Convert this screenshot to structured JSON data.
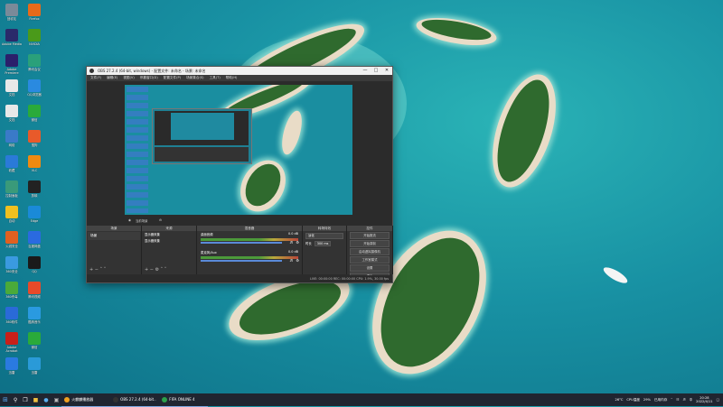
{
  "desktop": {
    "icons": [
      {
        "label": "回收站",
        "icon": "recycle-bin-icon",
        "color": "#7a8a99",
        "col": 0,
        "row": 0
      },
      {
        "label": "Adobe Media",
        "icon": "media-encoder-icon",
        "color": "#2a2a6a",
        "col": 0,
        "row": 1
      },
      {
        "label": "Adobe Premiere",
        "icon": "premiere-icon",
        "color": "#2b1f6b",
        "col": 0,
        "row": 2
      },
      {
        "label": "文档",
        "icon": "document-icon",
        "color": "#e8e8e8",
        "col": 0,
        "row": 3
      },
      {
        "label": "文档",
        "icon": "document-icon",
        "color": "#e8e8e8",
        "col": 0,
        "row": 4
      },
      {
        "label": "网络",
        "icon": "network-icon",
        "color": "#3a7ac8",
        "col": 0,
        "row": 5
      },
      {
        "label": "收藏",
        "icon": "star-icon",
        "color": "#2a7ad8",
        "col": 0,
        "row": 6
      },
      {
        "label": "控制面板",
        "icon": "control-panel-icon",
        "color": "#3a9a7a",
        "col": 0,
        "row": 7
      },
      {
        "label": "自动",
        "icon": "auto-icon",
        "color": "#f0c020",
        "col": 0,
        "row": 8
      },
      {
        "label": "火绒安全",
        "icon": "shield-app-icon",
        "color": "#e06020",
        "col": 0,
        "row": 9
      },
      {
        "label": "360安全",
        "icon": "security-360-icon",
        "color": "#3a9ae0",
        "col": 0,
        "row": 10
      },
      {
        "label": "360杀毒",
        "icon": "antivirus-icon",
        "color": "#4aaa3a",
        "col": 0,
        "row": 11
      },
      {
        "label": "360软件",
        "icon": "software-icon",
        "color": "#2a6ad8",
        "col": 0,
        "row": 12
      },
      {
        "label": "Adobe Acrobat",
        "icon": "acrobat-icon",
        "color": "#c8201a",
        "col": 0,
        "row": 13
      },
      {
        "label": "迅雷",
        "icon": "thunder-icon",
        "color": "#2a7ae0",
        "col": 0,
        "row": 14
      },
      {
        "label": "Firefox",
        "icon": "firefox-icon",
        "color": "#e86a1a",
        "col": 1,
        "row": 0
      },
      {
        "label": "NVIDIA",
        "icon": "nvidia-icon",
        "color": "#4a9a1a",
        "col": 1,
        "row": 1
      },
      {
        "label": "腾讯会议",
        "icon": "meeting-icon",
        "color": "#2aa07a",
        "col": 1,
        "row": 2
      },
      {
        "label": "QQ浏览器",
        "icon": "qq-browser-icon",
        "color": "#2a8ae0",
        "col": 1,
        "row": 3
      },
      {
        "label": "微信",
        "icon": "wechat-icon",
        "color": "#2aaa3a",
        "col": 1,
        "row": 4
      },
      {
        "label": "搜狗",
        "icon": "sogou-icon",
        "color": "#e85a2a",
        "col": 1,
        "row": 5
      },
      {
        "label": "VLC",
        "icon": "vlc-icon",
        "color": "#f08a10",
        "col": 1,
        "row": 6
      },
      {
        "label": "剪映",
        "icon": "capcut-icon",
        "color": "#222222",
        "col": 1,
        "row": 7
      },
      {
        "label": "Edge",
        "icon": "edge-icon",
        "color": "#1a8ad8",
        "col": 1,
        "row": 8
      },
      {
        "label": "百度网盘",
        "icon": "netdisk-icon",
        "color": "#2a6ae0",
        "col": 1,
        "row": 9
      },
      {
        "label": "QQ",
        "icon": "qq-icon",
        "color": "#1a1a1a",
        "col": 1,
        "row": 10
      },
      {
        "label": "腾讯视频",
        "icon": "tencent-video-icon",
        "color": "#e84a2a",
        "col": 1,
        "row": 11
      },
      {
        "label": "酷狗音乐",
        "icon": "kugou-icon",
        "color": "#2a9ae0",
        "col": 1,
        "row": 12
      },
      {
        "label": "微信",
        "icon": "wechat-icon",
        "color": "#2aaa3a",
        "col": 1,
        "row": 13
      },
      {
        "label": "迅雷",
        "icon": "thunder-icon",
        "color": "#2a9ad8",
        "col": 1,
        "row": 14
      }
    ]
  },
  "obs": {
    "title": "OBS 27.2.4 (64-bit, windows) - 配置文件: 未命名 - 场景: 未命名",
    "menu": [
      "文件(F)",
      "编辑(E)",
      "视图(V)",
      "停靠窗口(D)",
      "配置文件(P)",
      "场景集合(S)",
      "工具(T)",
      "帮助(H)"
    ],
    "controls_row": "当前场景",
    "docks": {
      "scenes": "场景",
      "sources": "来源",
      "mixer": "混音器",
      "transitions": "转场特效",
      "controls": "控件"
    },
    "scene_item": "场景",
    "source_items": [
      "显示器采集",
      "显示器采集"
    ],
    "mixer_tracks": [
      {
        "name": "桌面音频",
        "db": "0.0 dB"
      },
      {
        "name": "麦克风/Aux",
        "db": "0.0 dB"
      }
    ],
    "transition": {
      "type": "淡化",
      "duration_label": "时长",
      "duration": "300 ms"
    },
    "control_buttons": [
      "开始推流",
      "开始录制",
      "启动虚拟摄像机",
      "工作室模式",
      "设置",
      "退出"
    ],
    "status": "LIVE: 00:00:00   REC: 00:00:00   CPU: 1.9%, 30.00 fps"
  },
  "taskbar": {
    "items": [
      {
        "label": "火麒麟播放器",
        "icon": "player-icon",
        "color": "#f0a020"
      },
      {
        "label": "OBS 27.2.4 (64-bit...",
        "icon": "obs-icon",
        "color": "#333333"
      },
      {
        "label": "FIFA ONLINE 4",
        "icon": "fifa-icon",
        "color": "#2aa04a"
      }
    ],
    "tray": {
      "weather": "26°C",
      "cpu": "CPU温度",
      "battery": "29%",
      "net": "已用内存",
      "time": "20:28",
      "date": "2022/4/11"
    }
  },
  "colors": {
    "wallpaper": "#1891a3",
    "taskbar": "#202530",
    "obs_bg": "#2b2b2b"
  }
}
